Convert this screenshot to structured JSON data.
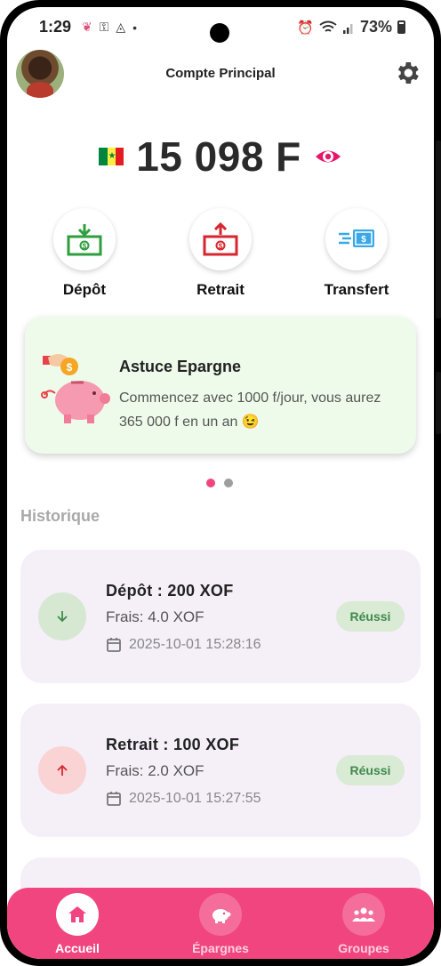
{
  "status_bar": {
    "time": "1:29",
    "battery": "73%"
  },
  "header": {
    "title": "Compte Principal"
  },
  "balance": {
    "amount": "15 098 F"
  },
  "actions": [
    {
      "label": "Dépôt",
      "icon": "cash-deposit-icon"
    },
    {
      "label": "Retrait",
      "icon": "cash-withdraw-icon"
    },
    {
      "label": "Transfert",
      "icon": "money-transfer-icon"
    }
  ],
  "tip": {
    "title": "Astuce Epargne",
    "text": "Commencez avec 1000 f/jour, vous aurez 365 000 f en un an 😉"
  },
  "carousel": {
    "active_color": "#f1457f",
    "inactive_color": "#9e9e9e"
  },
  "history": {
    "title": "Historique",
    "items": [
      {
        "title": "Dépôt : 200 XOF",
        "fee": "Frais: 4.0 XOF",
        "date": "2025-10-01 15:28:16",
        "status": "Réussi",
        "direction": "down"
      },
      {
        "title": "Retrait : 100 XOF",
        "fee": "Frais: 2.0 XOF",
        "date": "2025-10-01 15:27:55",
        "status": "Réussi",
        "direction": "up"
      }
    ]
  },
  "bottom_nav": [
    {
      "label": "Accueil",
      "icon": "home-icon",
      "active": true
    },
    {
      "label": "Épargnes",
      "icon": "piggy-bank-icon",
      "active": false
    },
    {
      "label": "Groupes",
      "icon": "groups-icon",
      "active": false
    }
  ],
  "colors": {
    "accent": "#f1457f",
    "success_bg": "#d9ead5",
    "success_text": "#3f8a4c",
    "tip_bg": "#eefbea",
    "card_bg": "#f5eff8"
  }
}
